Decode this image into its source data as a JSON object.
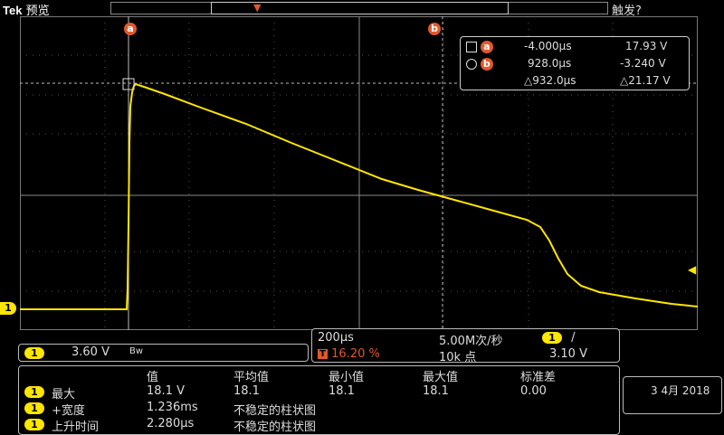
{
  "header": {
    "brand": "Tek",
    "mode": "预览",
    "trigger_label": "触发?"
  },
  "cursor_labels": {
    "a": "a",
    "b": "b"
  },
  "cursor_readout": {
    "a_time": "-4.000µs",
    "a_value": "17.93 V",
    "b_time": "928.0µs",
    "b_value": "-3.240 V",
    "delta_time": "△932.0µs",
    "delta_value": "△21.17 V"
  },
  "channel": {
    "number": "1",
    "scale": "3.60 V",
    "bw_icon": "Bᴡ"
  },
  "timebase": {
    "horizontal_scale": "200µs",
    "sample_rate": "5.00M次/秒",
    "trigger_position": "16.20 %",
    "record_length": "10k 点",
    "trigger_level": "3.10 V",
    "trigger_channel": "1",
    "trigger_slope": "/"
  },
  "measurements": {
    "headers": [
      "值",
      "平均值",
      "最小值",
      "最大值",
      "标准差"
    ],
    "rows": [
      {
        "channel": "1",
        "name": "最大",
        "value": "18.1 V",
        "mean": "18.1",
        "min": "18.1",
        "max": "18.1",
        "std": "0.00"
      },
      {
        "channel": "1",
        "name": "+宽度",
        "value": "1.236ms",
        "mean": "不稳定的柱状图"
      },
      {
        "channel": "1",
        "name": "上升时间",
        "value": "2.280µs",
        "mean": "不稳定的柱状图"
      }
    ]
  },
  "date": {
    "text": "3 4月 2018"
  },
  "colors": {
    "trace": "#ffe600",
    "cursor_badge": "#e2582a",
    "grid": "#666666"
  }
}
